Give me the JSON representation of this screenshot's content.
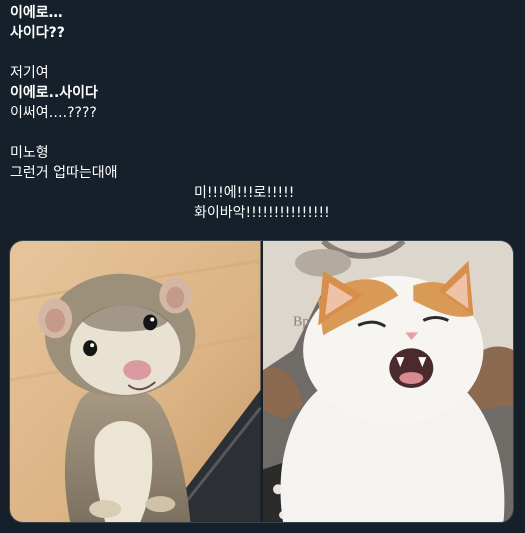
{
  "tweet": {
    "clipped_top_line": "··· ·· ·· · ·· ·",
    "lines": [
      "이에로…",
      "사이다??",
      "저기여",
      "이에로..사이다",
      "이써여….????",
      "미노형",
      "그런거 업따는대애",
      "미!!!에!!!로!!!!!",
      "화이바악!!!!!!!!!!!!!!!"
    ]
  },
  "media": {
    "photos": [
      {
        "icon": "ferret-photo"
      },
      {
        "icon": "cat-photo"
      }
    ]
  }
}
